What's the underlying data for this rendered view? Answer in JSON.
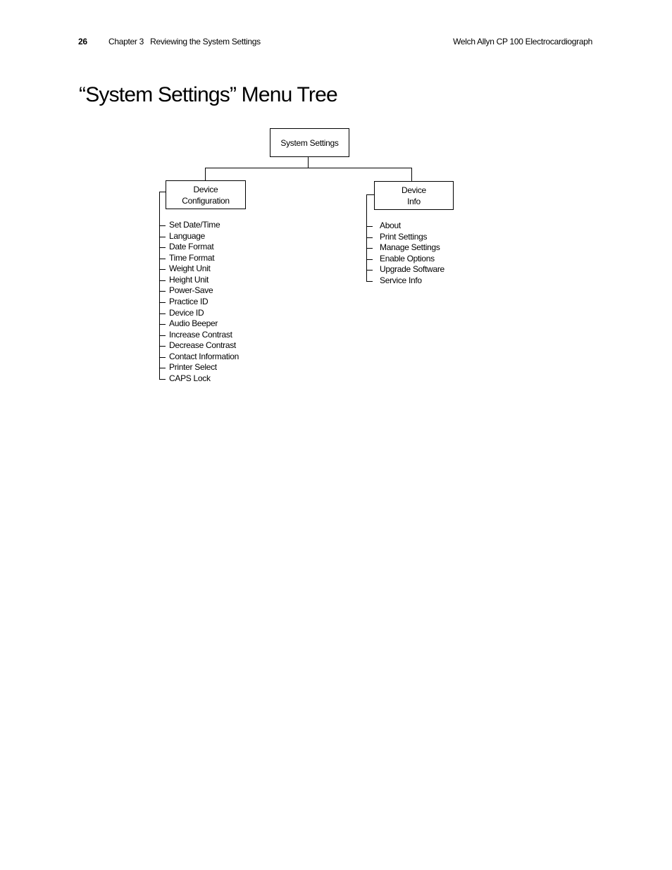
{
  "header": {
    "page_number": "26",
    "chapter": "Chapter 3   Reviewing the System Settings",
    "product": "Welch Allyn CP 100 Electrocardiograph"
  },
  "title": "“System Settings” Menu Tree",
  "tree": {
    "root": "System Settings",
    "branches": [
      {
        "label_line1": "Device",
        "label_line2": "Configuration",
        "items": [
          "Set Date/Time",
          "Language",
          "Date Format",
          "Time Format",
          "Weight Unit",
          "Height Unit",
          "Power-Save",
          "Practice ID",
          "Device ID",
          "Audio Beeper",
          "Increase Contrast",
          "Decrease Contrast",
          "Contact Information",
          "Printer Select",
          "CAPS Lock"
        ]
      },
      {
        "label_line1": "Device",
        "label_line2": "Info",
        "items": [
          "About",
          "Print Settings",
          "Manage Settings",
          "Enable Options",
          "Upgrade Software",
          "Service Info"
        ]
      }
    ]
  }
}
